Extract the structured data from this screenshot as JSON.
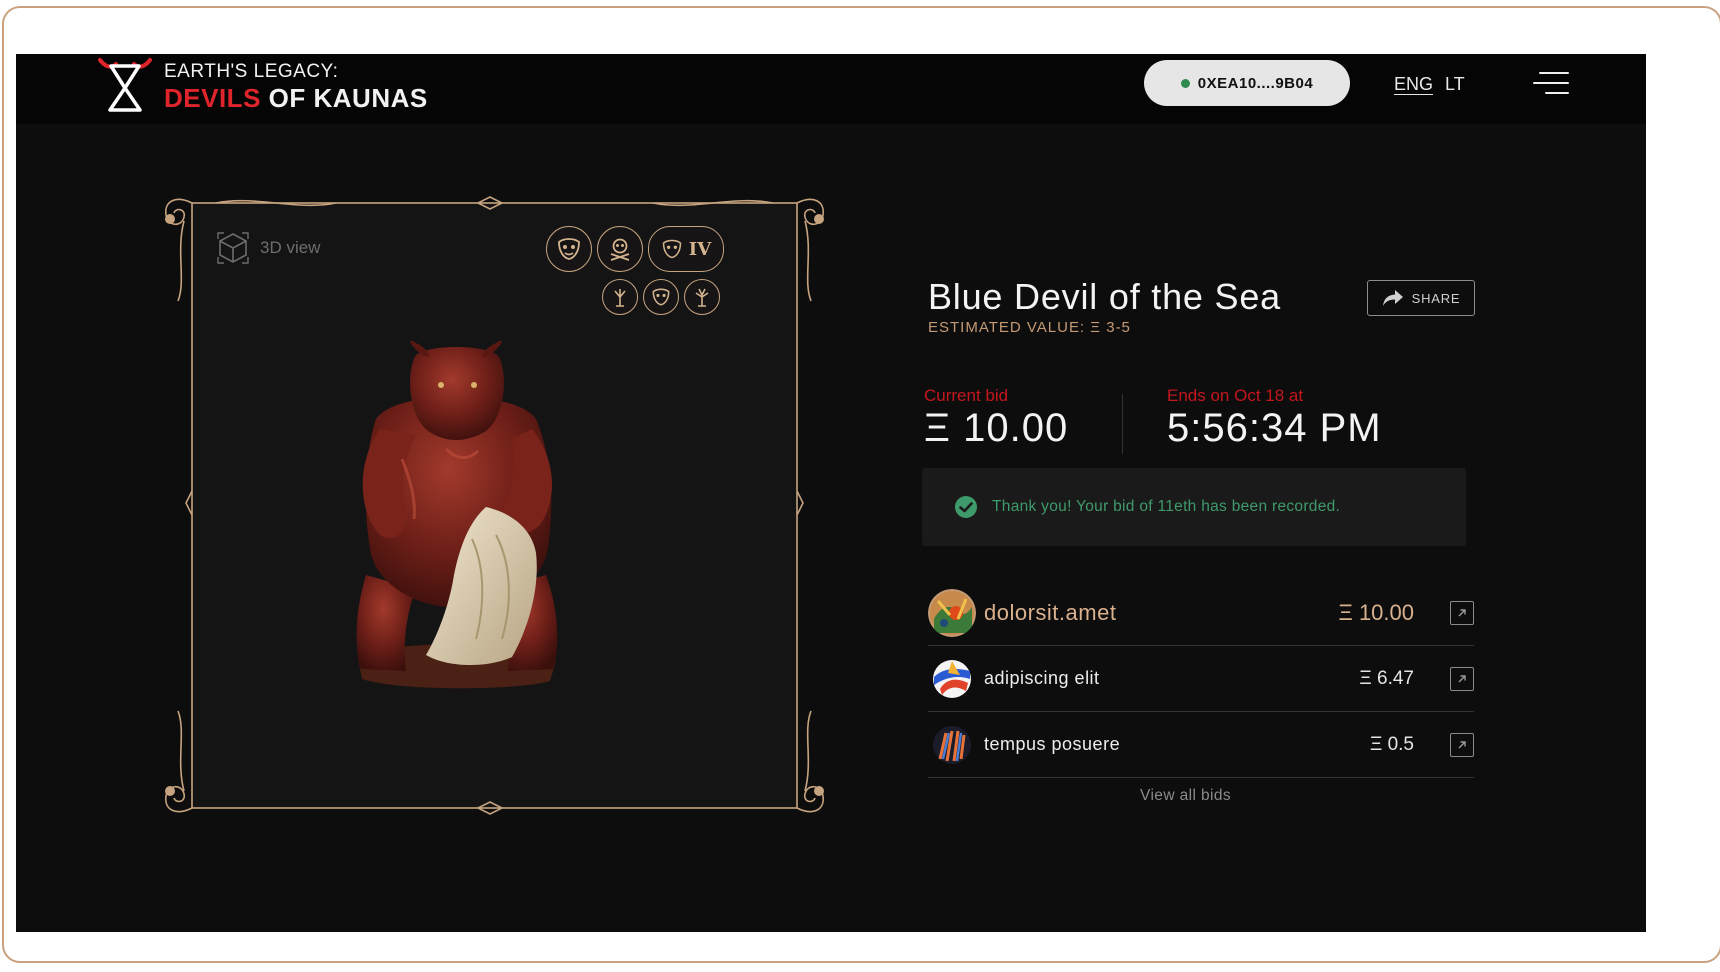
{
  "header": {
    "logo_line1": "EARTH'S LEGACY:",
    "logo_red": "DEVILS",
    "logo_white": "OF KAUNAS",
    "wallet_address": "0XEA10....9B04",
    "languages": [
      {
        "label": "ENG",
        "active": true
      },
      {
        "label": "LT",
        "active": false
      }
    ]
  },
  "viewer": {
    "view_label": "3D view",
    "badges_top": [
      {
        "icon": "mask-icon"
      },
      {
        "icon": "skull-crossbones-icon"
      },
      {
        "icon": "mask-icon",
        "text": "IV"
      }
    ],
    "badges_bottom": [
      {
        "icon": "tree-icon"
      },
      {
        "icon": "mask-icon"
      },
      {
        "icon": "tree-icon"
      }
    ]
  },
  "item": {
    "title": "Blue Devil of the Sea",
    "estimated_value": "ESTIMATED VALUE:  Ξ 3-5",
    "share_label": "SHARE",
    "current_bid_label": "Current bid",
    "current_bid_value": "Ξ 10.00",
    "ends_label": "Ends on Oct 18 at",
    "ends_value": "5:56:34 PM",
    "notice": "Thank you! Your bid of 11eth has been recorded."
  },
  "bids": [
    {
      "name": "dolorsit.amet",
      "amount": "Ξ 10.00",
      "highlight": true
    },
    {
      "name": "adipiscing elit",
      "amount": "Ξ 6.47",
      "highlight": false
    },
    {
      "name": "tempus posuere",
      "amount": "Ξ 0.5",
      "highlight": false
    }
  ],
  "view_all_label": "View all bids",
  "colors": {
    "accent_red": "#e0242b",
    "gold": "#c49a74",
    "success_green": "#3f9a6b",
    "background": "#0e0d0e"
  }
}
